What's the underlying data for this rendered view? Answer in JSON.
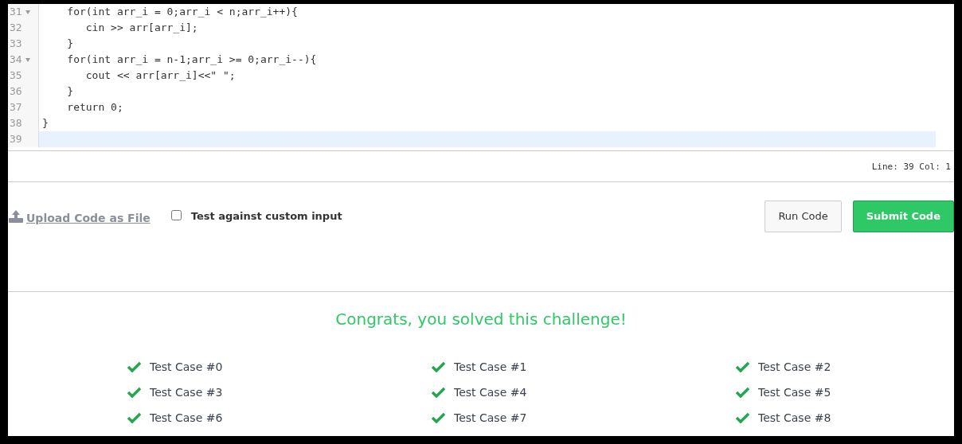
{
  "editor": {
    "lines": [
      {
        "number": "31",
        "foldable": true,
        "code": "    for(int arr_i = 0;arr_i < n;arr_i++){"
      },
      {
        "number": "32",
        "foldable": false,
        "code": "       cin >> arr[arr_i];"
      },
      {
        "number": "33",
        "foldable": false,
        "code": "    }"
      },
      {
        "number": "34",
        "foldable": true,
        "code": "    for(int arr_i = n-1;arr_i >= 0;arr_i--){"
      },
      {
        "number": "35",
        "foldable": false,
        "code": "       cout << arr[arr_i]<<\" \";"
      },
      {
        "number": "36",
        "foldable": false,
        "code": "    }"
      },
      {
        "number": "37",
        "foldable": false,
        "code": "    return 0;"
      },
      {
        "number": "38",
        "foldable": false,
        "code": "}"
      },
      {
        "number": "39",
        "foldable": false,
        "current": true
      }
    ],
    "status": "Line: 39 Col: 1"
  },
  "actions": {
    "upload_link": "Upload Code as File",
    "custom_input": {
      "label": "Test against custom input",
      "checked": false
    },
    "buttons": [
      {
        "label": "Run Code",
        "kind": "secondary"
      },
      {
        "label": "Submit Code",
        "kind": "primary"
      }
    ]
  },
  "result": {
    "message": "Congrats, you solved this challenge!",
    "test_cases": [
      {
        "label": "Test Case #0",
        "passed": true
      },
      {
        "label": "Test Case #1",
        "passed": true
      },
      {
        "label": "Test Case #2",
        "passed": true
      },
      {
        "label": "Test Case #3",
        "passed": true
      },
      {
        "label": "Test Case #4",
        "passed": true
      },
      {
        "label": "Test Case #5",
        "passed": true
      },
      {
        "label": "Test Case #6",
        "passed": true
      },
      {
        "label": "Test Case #7",
        "passed": true
      },
      {
        "label": "Test Case #8",
        "passed": true
      }
    ]
  }
}
